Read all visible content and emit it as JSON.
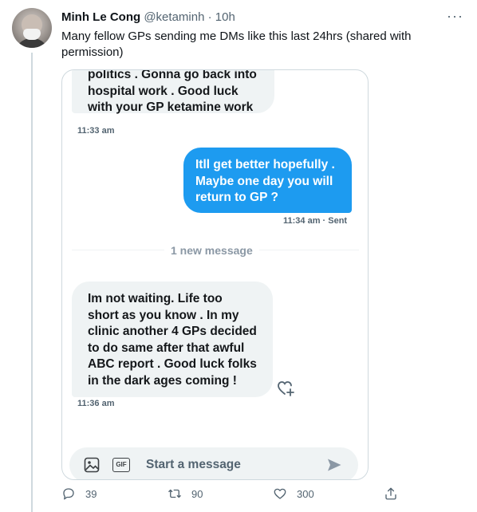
{
  "tweet": {
    "author_name": "Minh Le Cong",
    "handle": "@ketaminh",
    "separator": "·",
    "time": "10h",
    "more_label": "···",
    "text": "Many fellow GPs sending me DMs like this last 24hrs (shared with permission)"
  },
  "dm_screenshot": {
    "message_1": {
      "lines": [
        "politics . Gonna go back into",
        "hospital work . Good luck",
        "with your GP ketamine work"
      ],
      "time": "11:33 am"
    },
    "message_2": {
      "lines": [
        "Itll get better hopefully .",
        "Maybe one day you will",
        "return to GP ?"
      ],
      "time": "11:34 am · Sent"
    },
    "new_message_divider": "1 new message",
    "message_3": {
      "lines": [
        "Im not waiting. Life too",
        "short as you know . In my",
        "clinic another 4 GPs decided",
        "to do same after that awful",
        "ABC report . Good luck folks",
        "in the dark ages coming !"
      ],
      "time": "11:36 am"
    },
    "composer": {
      "placeholder": "Start a message",
      "gif_label": "GIF"
    }
  },
  "actions": {
    "replies": "39",
    "retweets": "90",
    "likes": "300"
  },
  "colors": {
    "accent": "#1d9bf0",
    "incoming_bubble": "#eff3f4",
    "secondary_text": "#536471"
  }
}
